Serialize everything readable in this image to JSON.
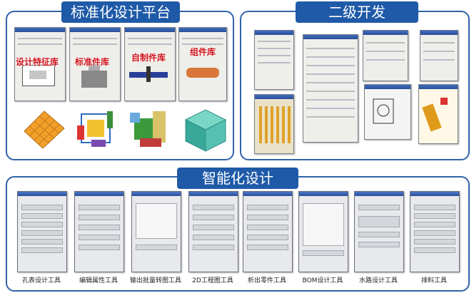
{
  "sections": {
    "platform": {
      "title": "标准化设计平台"
    },
    "secondary": {
      "title": "二级开发"
    },
    "intelligent": {
      "title": "智能化设计"
    }
  },
  "libraries": [
    {
      "label": "设计特征库"
    },
    {
      "label": "标准件库"
    },
    {
      "label": "自制件库"
    },
    {
      "label": "组件库"
    }
  ],
  "tools": [
    {
      "label": "孔表设计工具"
    },
    {
      "label": "编辑属性工具"
    },
    {
      "label": "输出批量转图工具"
    },
    {
      "label": "2D工程图工具"
    },
    {
      "label": "析出零件工具"
    },
    {
      "label": "BOM设计工具"
    },
    {
      "label": "水路设计工具"
    },
    {
      "label": "排料工具"
    }
  ],
  "colors": {
    "frame": "#2f63a8",
    "tab": "#1f5aa8",
    "library_label": "#d0141b"
  }
}
